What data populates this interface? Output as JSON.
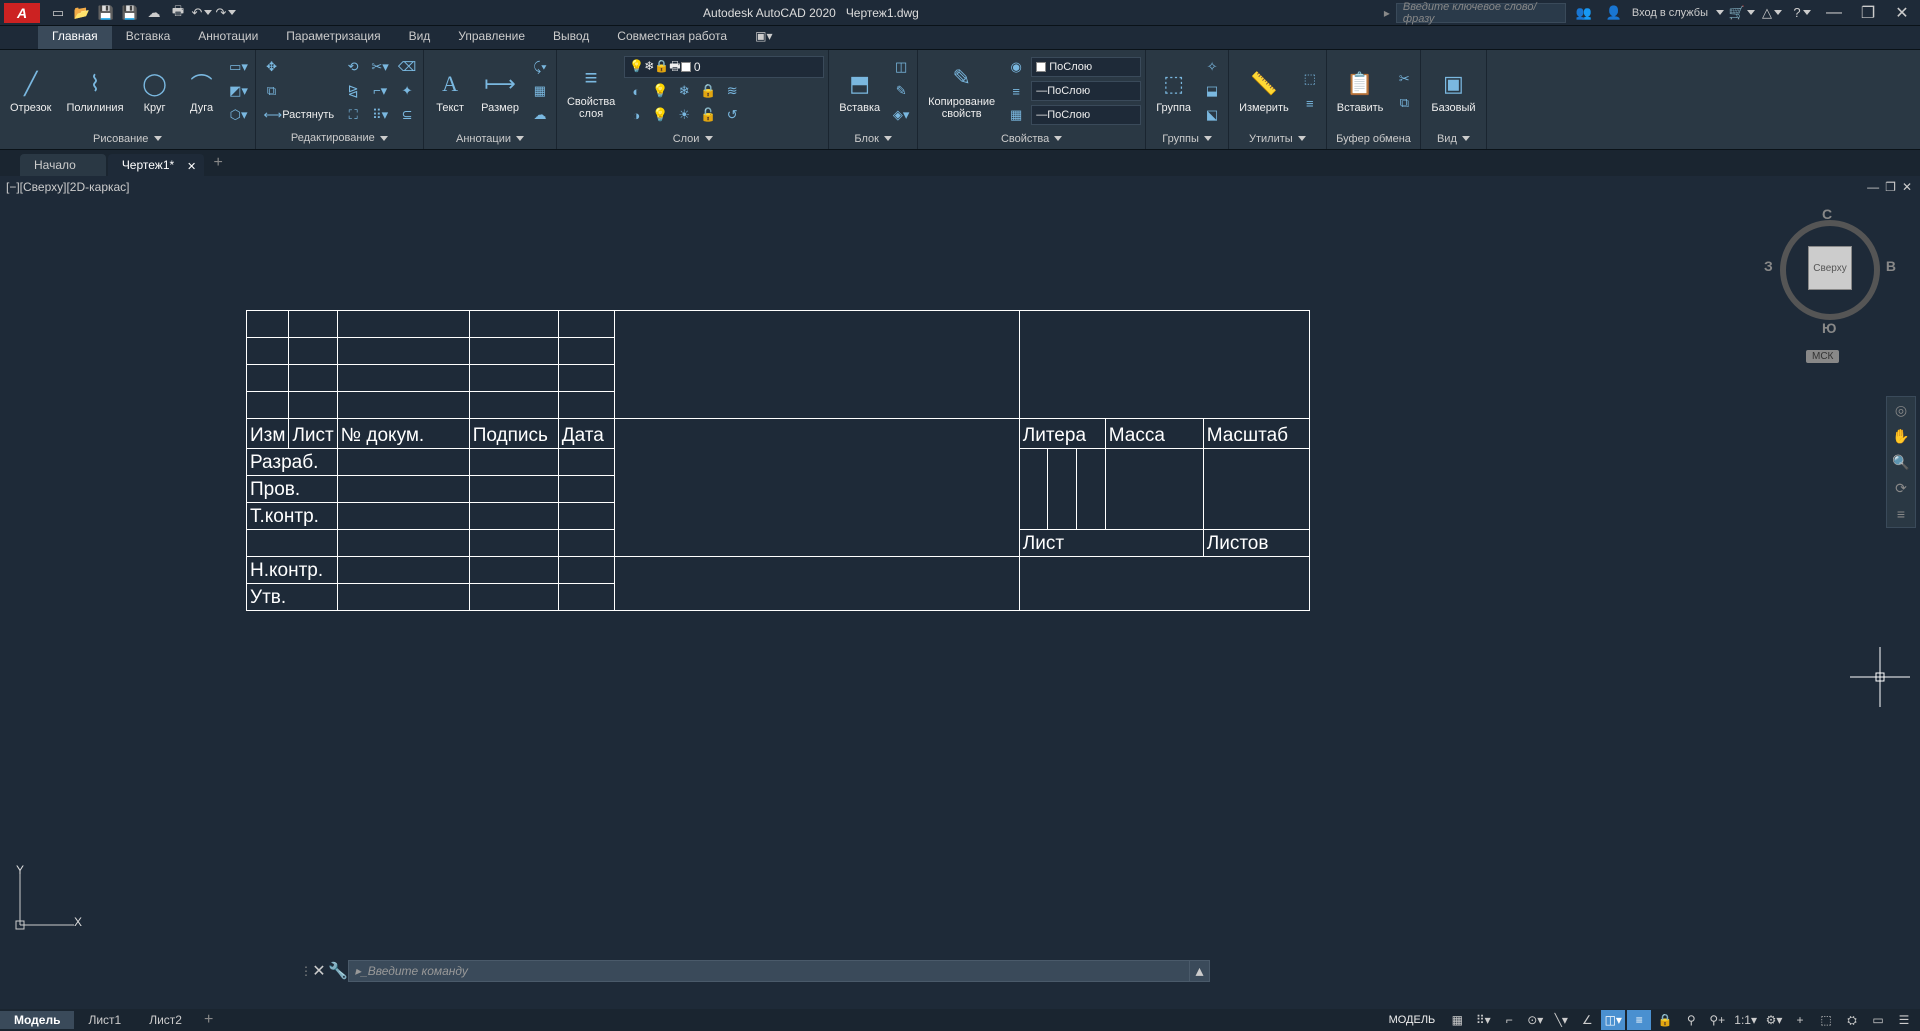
{
  "title": {
    "app": "Autodesk AutoCAD 2020",
    "file": "Чертеж1.dwg"
  },
  "search_placeholder": "Введите ключевое слово/фразу",
  "account_label": "Вход в службы",
  "menu_tabs": [
    "Главная",
    "Вставка",
    "Аннотации",
    "Параметризация",
    "Вид",
    "Управление",
    "Вывод",
    "Совместная работа"
  ],
  "ribbon": {
    "draw": {
      "label": "Рисование",
      "line": "Отрезок",
      "pline": "Полилиния",
      "circle": "Круг",
      "arc": "Дуга"
    },
    "modify": {
      "label": "Редактирование",
      "stretch": "Растянуть"
    },
    "annot": {
      "label": "Аннотации",
      "text": "Текст",
      "dim": "Размер"
    },
    "layers": {
      "label": "Слои",
      "props": "Свойства\nслоя",
      "current": "0"
    },
    "block": {
      "label": "Блок",
      "insert": "Вставка"
    },
    "props": {
      "label": "Свойства",
      "match": "Копирование\nсвойств",
      "bylayer": "ПоСлою"
    },
    "groups": {
      "label": "Группы",
      "group": "Группа"
    },
    "utils": {
      "label": "Утилиты",
      "measure": "Измерить"
    },
    "clip": {
      "label": "Буфер обмена",
      "paste": "Вставить"
    },
    "view": {
      "label": "Вид",
      "base": "Базовый"
    }
  },
  "doc_tabs": {
    "start": "Начало",
    "doc": "Чертеж1*"
  },
  "viewport_label": "[−][Сверху][2D-каркас]",
  "viewcube": {
    "face": "Сверху",
    "n": "С",
    "s": "Ю",
    "e": "В",
    "w": "З",
    "wcs": "МСК"
  },
  "ucs": {
    "x": "X",
    "y": "Y"
  },
  "cmd_placeholder": "Введите команду",
  "layout_tabs": {
    "model": "Модель",
    "l1": "Лист1",
    "l2": "Лист2"
  },
  "status_model": "МОДЕЛЬ",
  "status_scale": "1:1",
  "titleblock": {
    "izm": "Изм",
    "list": "Лист",
    "docnum": "№ докум.",
    "sign": "Подпись",
    "date": "Дата",
    "razrab": "Разраб.",
    "prov": "Пров.",
    "tkontr": "Т.контр.",
    "nkontr": "Н.контр.",
    "utv": "Утв.",
    "litera": "Литера",
    "massa": "Масса",
    "mashtab": "Масштаб",
    "list2": "Лист",
    "listov": "Листов"
  }
}
